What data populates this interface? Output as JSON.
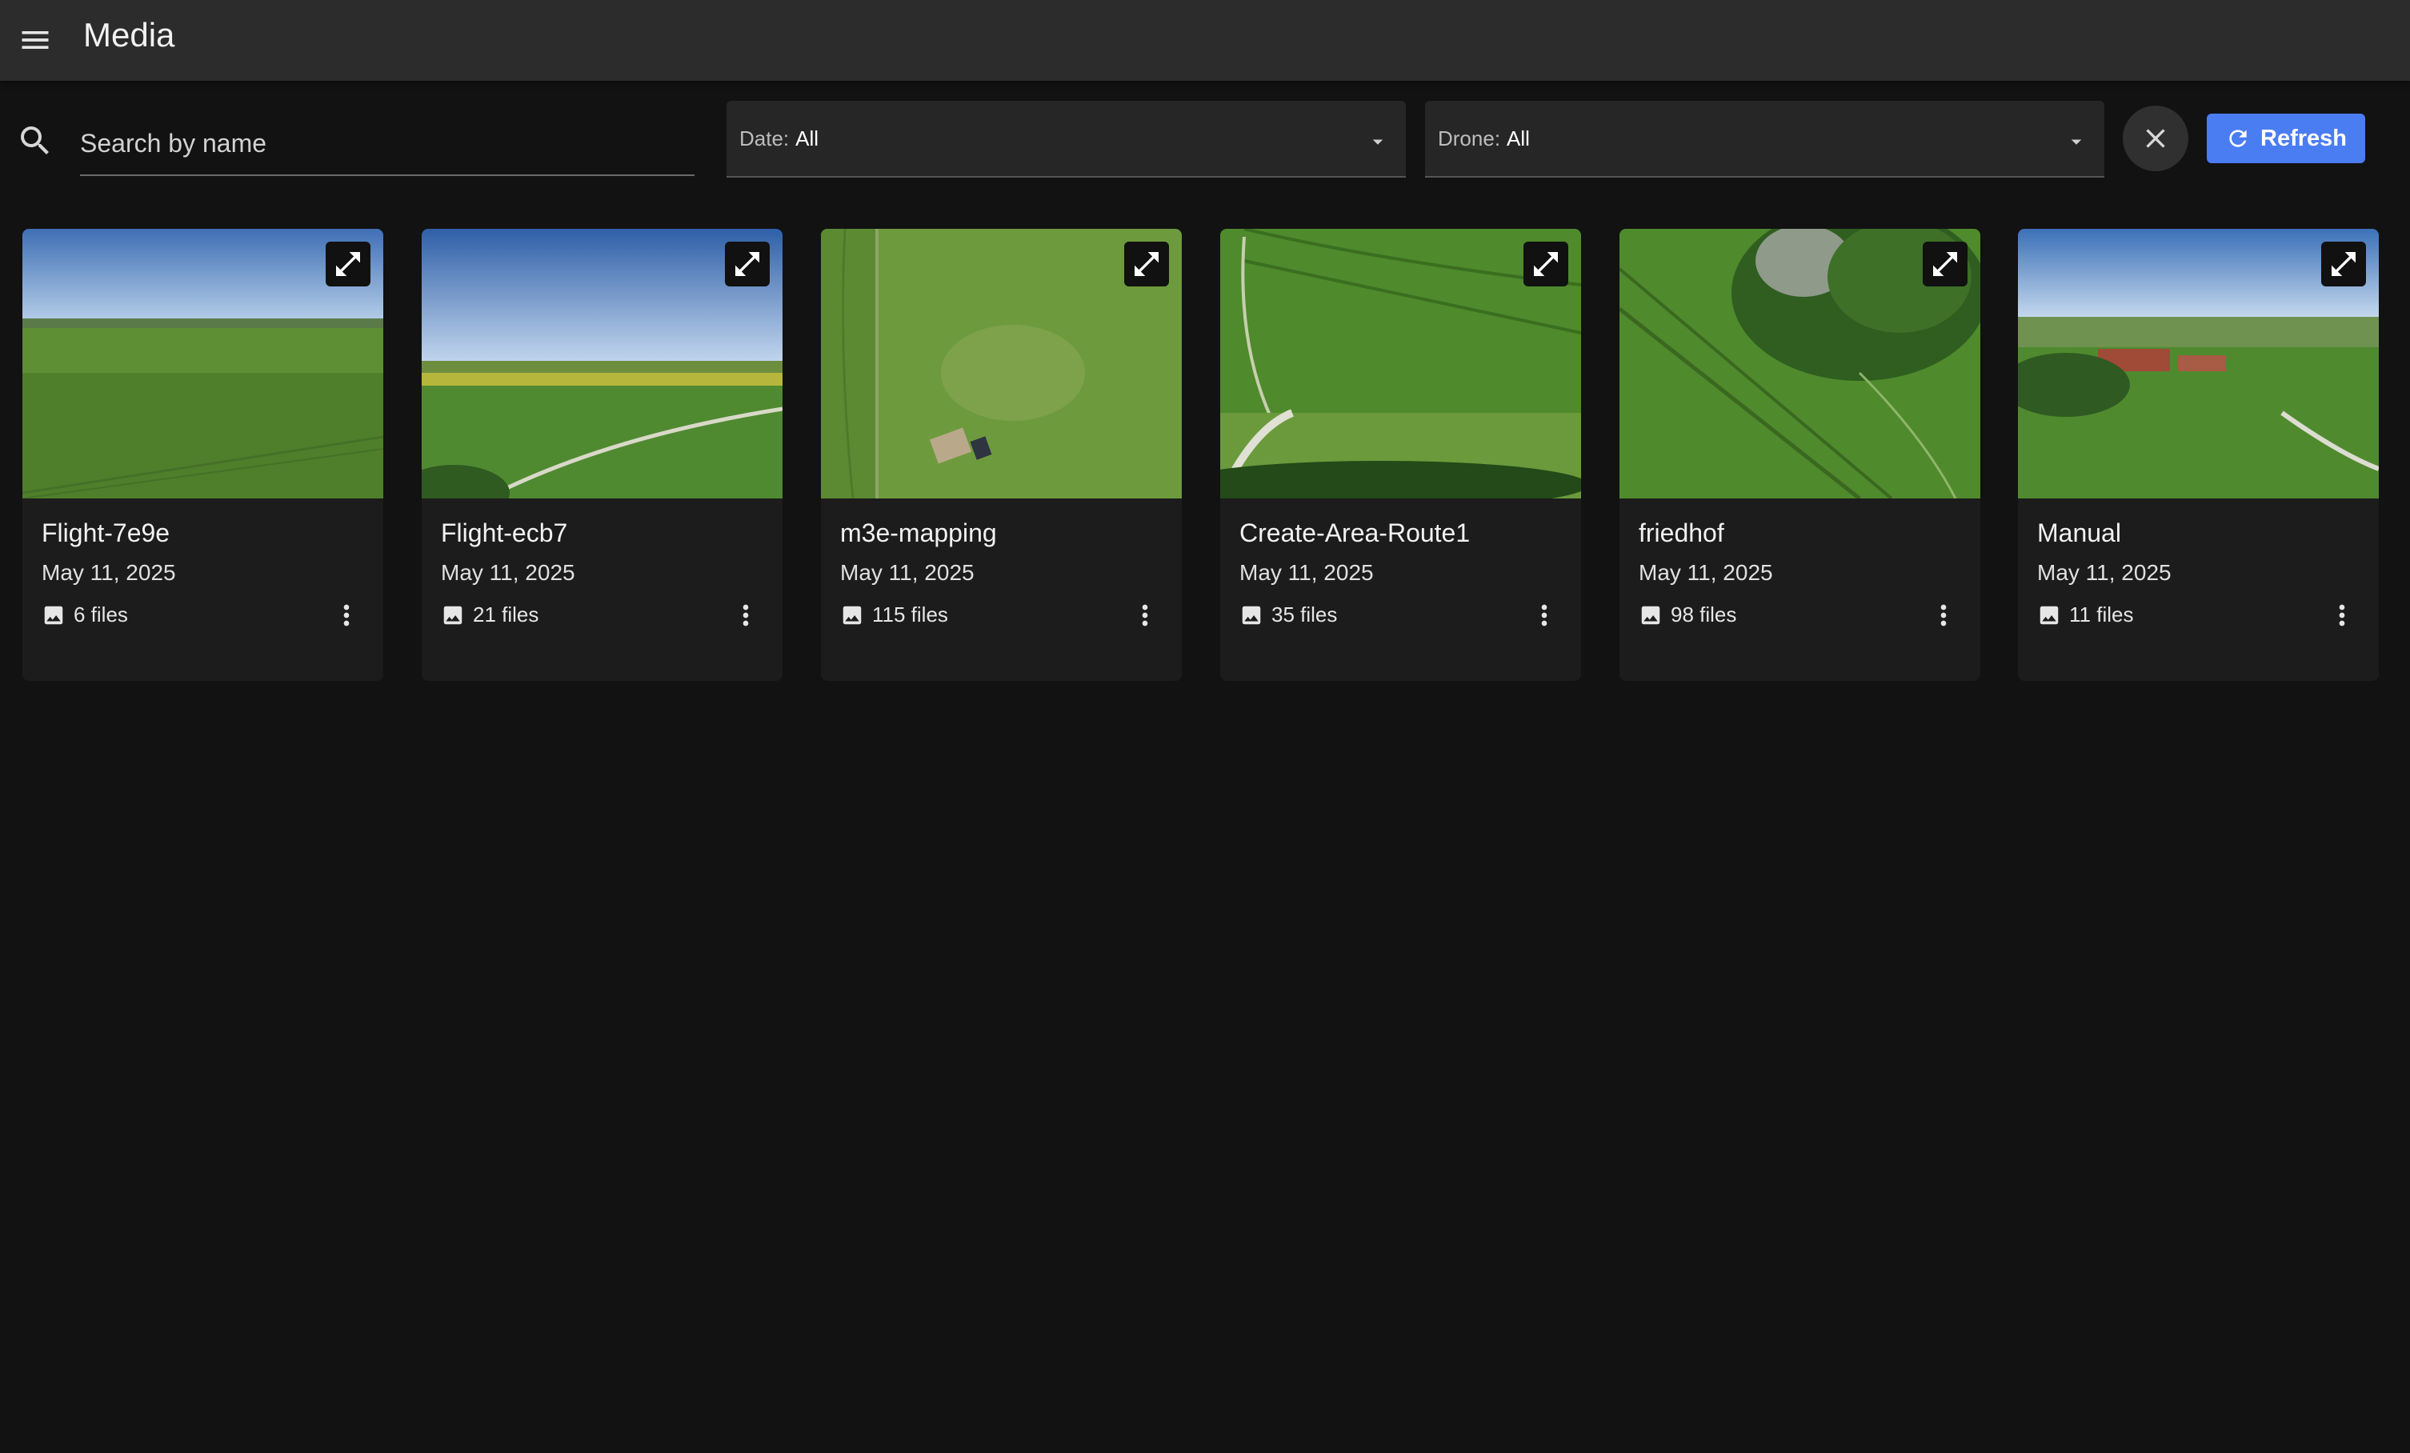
{
  "app": {
    "title": "Media"
  },
  "filters": {
    "search_placeholder": "Search by name",
    "date_label": "Date:",
    "date_value": "All",
    "drone_label": "Drone:",
    "drone_value": "All",
    "refresh_label": "Refresh"
  },
  "colors": {
    "appbar": "#2c2c2c",
    "background": "#121212",
    "card": "#1c1c1c",
    "accent": "#4a7cf2"
  },
  "icons": {
    "menu": "menu-icon",
    "search": "search-icon",
    "caret": "arrow-drop-down-icon",
    "clear": "close-icon",
    "refresh": "refresh-icon",
    "expand": "open-in-full-icon",
    "image": "image-icon",
    "more": "more-vert-icon"
  },
  "cards": [
    {
      "title": "Flight-7e9e",
      "date": "May 11, 2025",
      "files": "6 files"
    },
    {
      "title": "Flight-ecb7",
      "date": "May 11, 2025",
      "files": "21 files"
    },
    {
      "title": "m3e-mapping",
      "date": "May 11, 2025",
      "files": "115 files"
    },
    {
      "title": "Create-Area-Route1",
      "date": "May 11, 2025",
      "files": "35 files"
    },
    {
      "title": "friedhof",
      "date": "May 11, 2025",
      "files": "98 files"
    },
    {
      "title": "Manual",
      "date": "May 11, 2025",
      "files": "11 files"
    }
  ]
}
